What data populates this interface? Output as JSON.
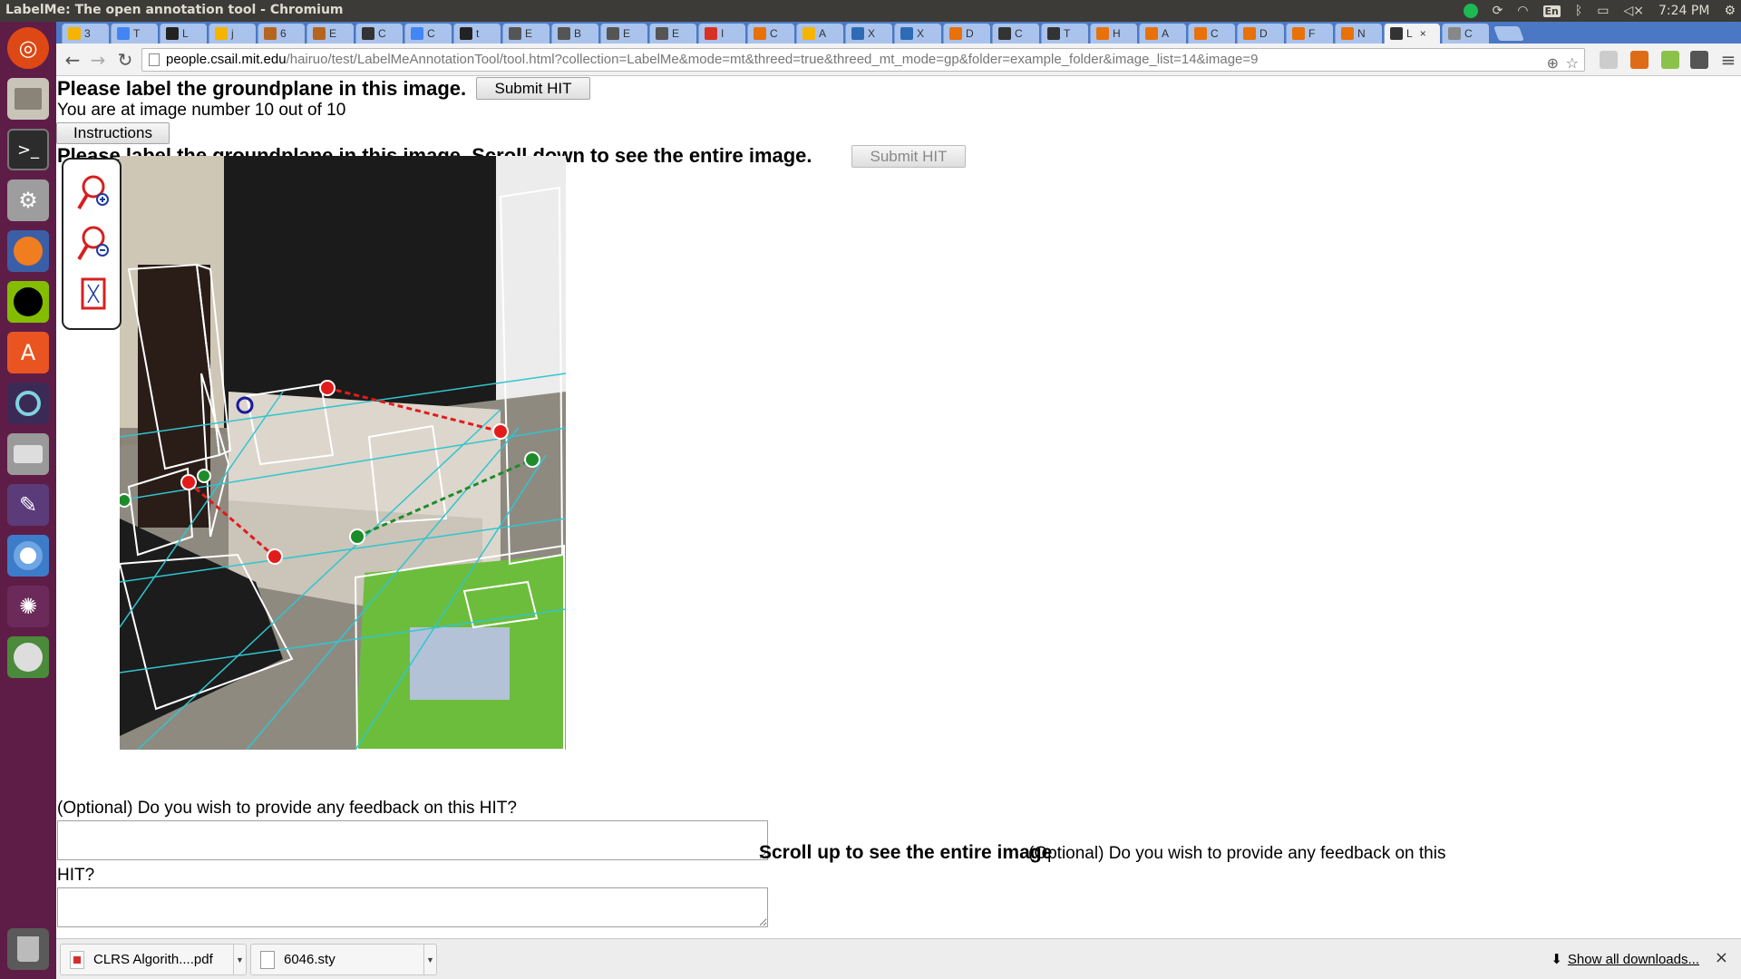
{
  "window": {
    "title": "LabelMe: The open annotation tool - Chromium",
    "clock": "7:24 PM",
    "keyboard_layout": "En"
  },
  "tabs": [
    {
      "label": "3",
      "color": "#f4b400"
    },
    {
      "label": "T",
      "color": "#4285f4"
    },
    {
      "label": "L",
      "color": "#222222"
    },
    {
      "label": "j",
      "color": "#f4b400"
    },
    {
      "label": "6",
      "color": "#b5651d"
    },
    {
      "label": "E",
      "color": "#b5651d"
    },
    {
      "label": "C",
      "color": "#333333"
    },
    {
      "label": "C",
      "color": "#4285f4"
    },
    {
      "label": "t",
      "color": "#222222"
    },
    {
      "label": "E",
      "color": "#555555"
    },
    {
      "label": "B",
      "color": "#555555"
    },
    {
      "label": "E",
      "color": "#555555"
    },
    {
      "label": "E",
      "color": "#555555"
    },
    {
      "label": "I",
      "color": "#d93025"
    },
    {
      "label": "C",
      "color": "#e8710a"
    },
    {
      "label": "A",
      "color": "#f4b400"
    },
    {
      "label": "X",
      "color": "#2d6cb5"
    },
    {
      "label": "X",
      "color": "#2d6cb5"
    },
    {
      "label": "D",
      "color": "#e8710a"
    },
    {
      "label": "C",
      "color": "#333333"
    },
    {
      "label": "T",
      "color": "#333333"
    },
    {
      "label": "H",
      "color": "#e8710a"
    },
    {
      "label": "A",
      "color": "#e8710a"
    },
    {
      "label": "C",
      "color": "#e8710a"
    },
    {
      "label": "D",
      "color": "#e8710a"
    },
    {
      "label": "F",
      "color": "#e8710a"
    },
    {
      "label": "N",
      "color": "#e8710a"
    },
    {
      "label": "L",
      "color": "#333333",
      "active": true
    },
    {
      "label": "C",
      "color": "#888888"
    }
  ],
  "active_tab_close": "×",
  "toolbar": {
    "url_host": "people.csail.mit.edu",
    "url_path": "/hairuo/test/LabelMeAnnotationTool/tool.html?collection=LabelMe&mode=mt&threed=true&threed_mt_mode=gp&folder=example_folder&image_list=14&image=9"
  },
  "page": {
    "heading": "Please label the groundplane in this image.",
    "submit_label": "Submit HIT",
    "progress_text": "You are at image number 10 out of 10",
    "instructions_label": "Instructions",
    "heading2": "Please label the groundplane in this image. Scroll down to see the entire image.",
    "submit2_label": "Submit HIT",
    "feedback_prompt": "(Optional) Do you wish to provide any feedback on this HIT?",
    "scroll_up_text": "Scroll up to see the entire image",
    "feedback_prompt2_a": "(Optional) Do you wish to provide any feedback on this",
    "feedback_prompt2_b": "HIT?"
  },
  "tools": [
    {
      "name": "zoom-in-icon"
    },
    {
      "name": "zoom-out-icon"
    },
    {
      "name": "fit-image-icon"
    }
  ],
  "downloads": {
    "items": [
      {
        "name": "CLRS Algorith....pdf",
        "type": "pdf"
      },
      {
        "name": "6046.sty",
        "type": "file"
      }
    ],
    "show_all": "Show all downloads...",
    "close": "×"
  }
}
